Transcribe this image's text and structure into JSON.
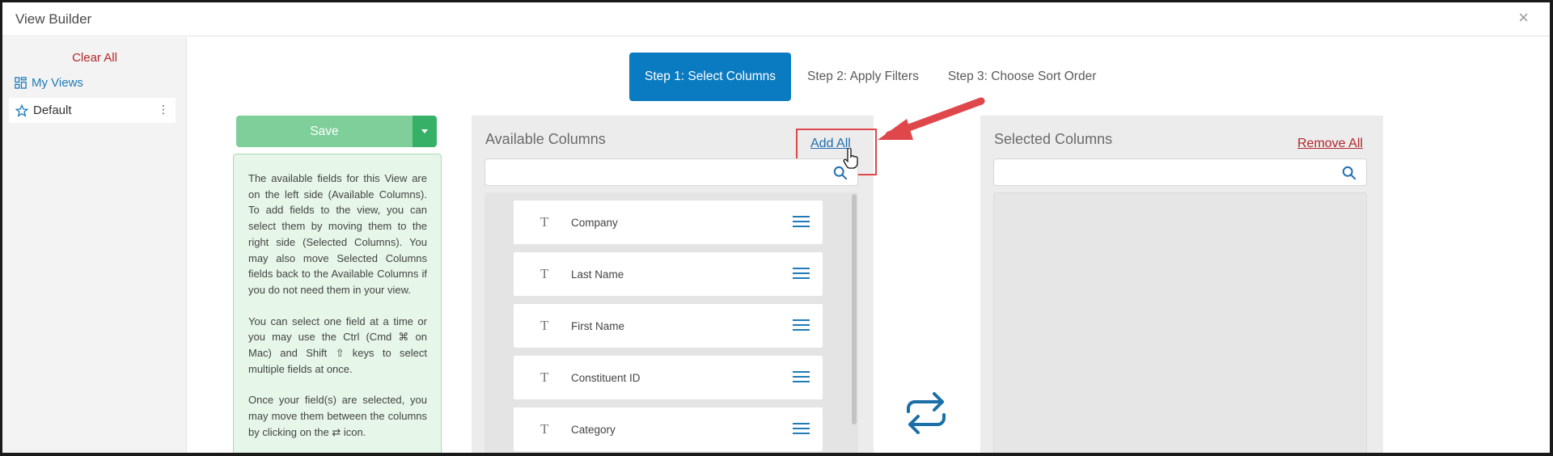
{
  "window": {
    "title": "View Builder",
    "close_glyph": "×"
  },
  "sidebar": {
    "clear_all": "Clear All",
    "my_views": "My Views",
    "default_view": "Default",
    "kebab_glyph": "⋮"
  },
  "steps": [
    {
      "label": "Step 1: Select Columns",
      "active": true
    },
    {
      "label": "Step 2: Apply Filters",
      "active": false
    },
    {
      "label": "Step 3: Choose Sort Order",
      "active": false
    }
  ],
  "toolbar": {
    "save_label": "Save"
  },
  "help": {
    "p1": "The available fields for this View are on the left side (Available Columns). To add fields to the view, you can select them by moving them to the right side (Selected Columns). You may also move Selected Columns fields back to the Available Columns if you do not need them in your view.",
    "p2": "You can select one field at a time or you may use the Ctrl (Cmd ⌘ on Mac) and Shift ⇧ keys to select multiple fields at once.",
    "p3": "Once your field(s) are selected, you may move them between the columns by clicking on the ⇄ icon."
  },
  "available": {
    "title": "Available Columns",
    "add_all": "Add All",
    "search_placeholder": "",
    "fields": [
      {
        "label": "Company",
        "type_glyph": "T"
      },
      {
        "label": "Last Name",
        "type_glyph": "T"
      },
      {
        "label": "First Name",
        "type_glyph": "T"
      },
      {
        "label": "Constituent ID",
        "type_glyph": "T"
      },
      {
        "label": "Category",
        "type_glyph": "T"
      }
    ]
  },
  "selected": {
    "title": "Selected Columns",
    "remove_all": "Remove All",
    "search_placeholder": ""
  },
  "colors": {
    "primary": "#0b7bc1",
    "save_bg": "#7fcf9a",
    "save_caret": "#37b067",
    "danger": "#b3262a",
    "annotation": "#e0474b",
    "help_bg": "#e6f6e8"
  },
  "icons": {
    "my_views": "grid-layout-icon",
    "default_view": "star-outline-icon",
    "search": "search-icon",
    "field_type": "text-type-icon",
    "drag": "hamburger-drag-icon",
    "transfer": "swap-arrows-icon",
    "annotation": "red-arrow-annotation",
    "cursor": "hand-pointer-cursor"
  }
}
